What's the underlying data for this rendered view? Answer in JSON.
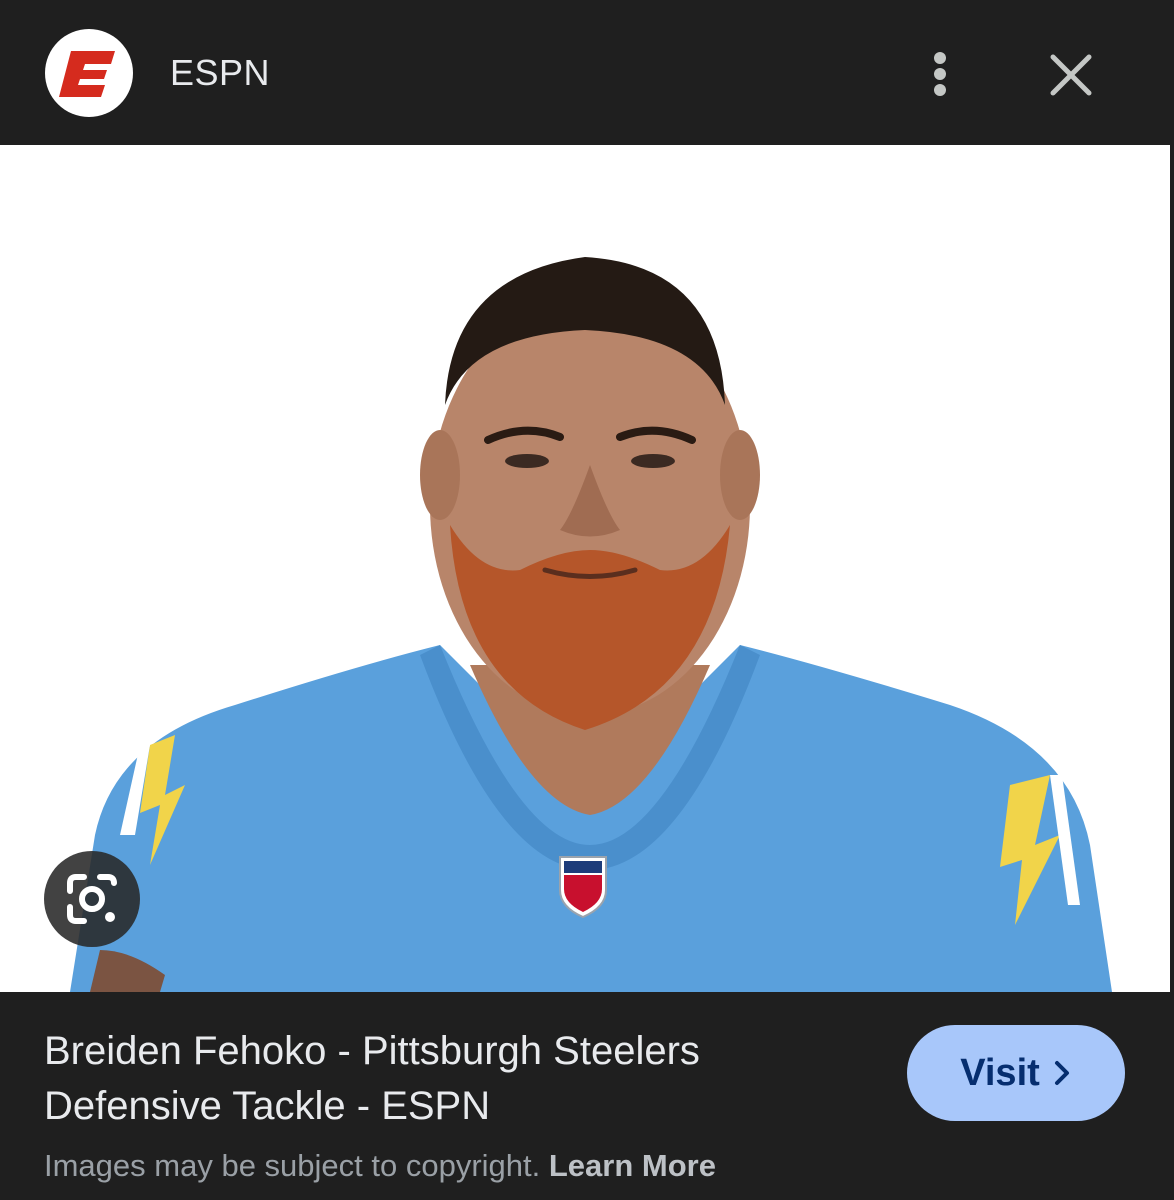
{
  "header": {
    "site_name": "ESPN",
    "logo_letter": "E"
  },
  "image": {
    "alt": "Breiden Fehoko - Pittsburgh Steelers Defensive Tackle - ESPN"
  },
  "result": {
    "title_line1": "Breiden Fehoko - Pittsburgh Steelers",
    "title_line2": "Defensive Tackle - ESPN",
    "visit_label": "Visit",
    "copyright_text": "Images may be subject to copyright.",
    "learn_more_label": "Learn More"
  },
  "colors": {
    "background": "#1f1f1f",
    "espn_red": "#d52b1e",
    "visit_button": "#a8c7fa",
    "jersey_blue": "#5aa0dc"
  },
  "icons": {
    "menu": "more-vert-icon",
    "close": "close-icon",
    "lens": "google-lens-icon",
    "visit": "chevron-right-icon"
  }
}
